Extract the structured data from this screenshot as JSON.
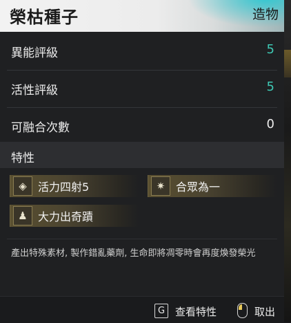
{
  "header": {
    "title": "榮枯種子",
    "category": "造物"
  },
  "stats": [
    {
      "label": "異能評級",
      "value": "5"
    },
    {
      "label": "活性評級",
      "value": "5"
    },
    {
      "label": "可融合次數",
      "value": "0"
    }
  ],
  "traits": {
    "heading": "特性",
    "items": [
      {
        "label": "活力四射5",
        "icon": "diamond-icon"
      },
      {
        "label": "合眾為一",
        "icon": "starburst-icon"
      },
      {
        "label": "大力出奇蹟",
        "icon": "figure-icon"
      }
    ]
  },
  "description": "產出特殊素材, 製作錯亂藥劑, 生命即將凋零時會再度煥發榮光",
  "footer": {
    "view_key": "G",
    "view_label": "查看特性",
    "cancel_label": "取出"
  },
  "colors": {
    "accent_teal": "#3ec8b4",
    "trait_gold": "#5a5031"
  }
}
